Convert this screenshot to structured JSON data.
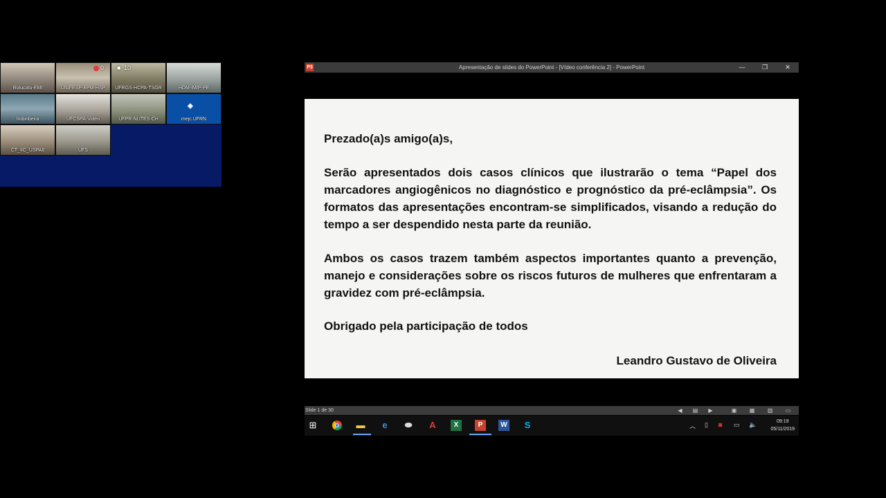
{
  "conference": {
    "tiles": [
      {
        "label": "Botucatu-EMI"
      },
      {
        "label": "UNIFESP-EPM-HSP"
      },
      {
        "label": "UFRGS-HCPA-TSGR"
      },
      {
        "label": "HDM-IMIP-PE"
      },
      {
        "label": "Imbiribeira"
      },
      {
        "label": "UFCSPA-Video"
      },
      {
        "label": "UFPR-NUTES-CH"
      },
      {
        "label": "mejc.UFRN"
      },
      {
        "label": "CT_IIC_USPA6"
      },
      {
        "label": "UFS"
      }
    ],
    "mic_count": "0",
    "viewer_count": "10"
  },
  "window": {
    "title": "Apresentação de slides do PowerPoint - [Vídeo conferência 2] - PowerPoint",
    "app_icon": "P3",
    "minimize": "—",
    "restore": "❐",
    "close": "✕"
  },
  "slide": {
    "greeting": "Prezado(a)s amigo(a)s,",
    "paragraph1": "Serão apresentados dois casos clínicos que ilustrarão o tema “Papel dos marcadores angiogênicos no diagnóstico e prognóstico da pré-eclâmpsia”. Os formatos das apresentações encontram-se simplificados, visando a redução do tempo a ser despendido nesta parte da reunião.",
    "paragraph2": "Ambos os casos trazem também aspectos importantes quanto a prevenção, manejo e considerações sobre os riscos futuros de mulheres que enfrentaram a gravidez com pré-eclâmpsia.",
    "paragraph3": "Obrigado pela participação de todos",
    "signature": "Leandro Gustavo de Oliveira"
  },
  "statusbar": {
    "slide_indicator": "Slide 1 de 30"
  },
  "taskbar": {
    "time": "09:19",
    "date": "05/11/2019"
  }
}
